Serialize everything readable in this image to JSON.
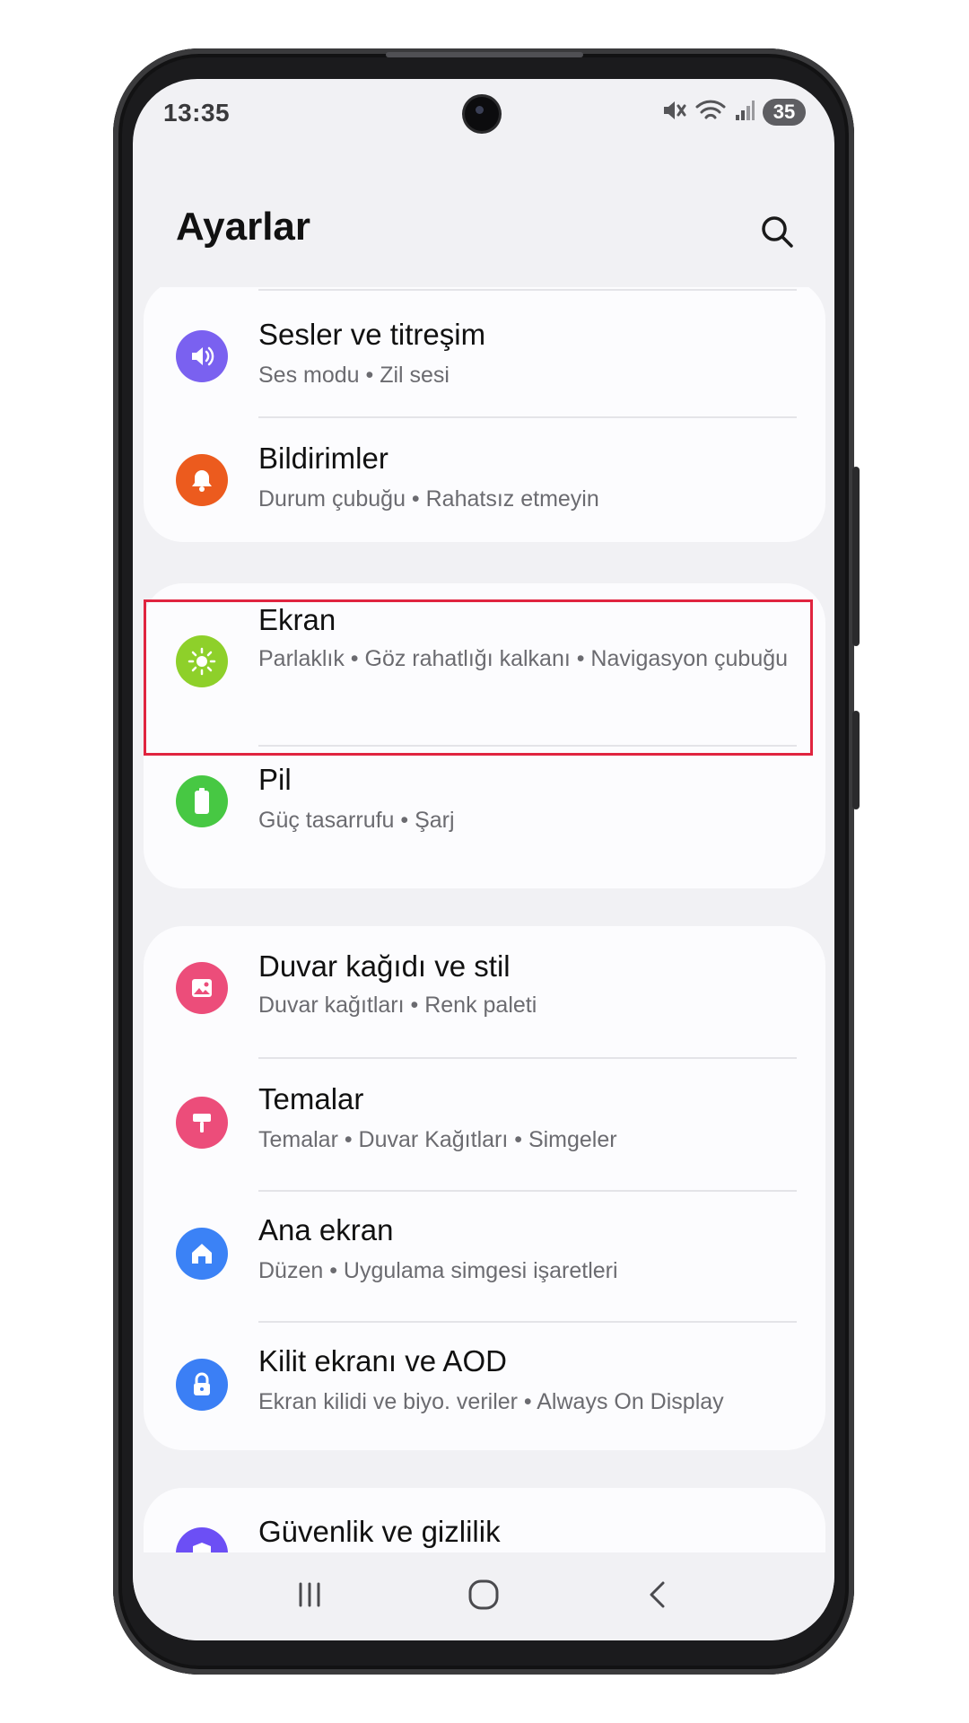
{
  "status_bar": {
    "time": "13:35",
    "battery_level": "35"
  },
  "header": {
    "title": "Ayarlar",
    "search_icon": "search-icon"
  },
  "groups": [
    {
      "items": [
        {
          "title": "Sesler ve titreşim",
          "subtitle": "Ses modu  •  Zil sesi",
          "icon": "speaker-icon",
          "color": "#7a61f0"
        },
        {
          "title": "Bildirimler",
          "subtitle": "Durum çubuğu  •  Rahatsız etmeyin",
          "icon": "bell-icon",
          "color": "#ec5b1e"
        }
      ]
    },
    {
      "items": [
        {
          "title": "Ekran",
          "subtitle": "Parlaklık  •  Göz rahatlığı kalkanı  •  Navigasyon çubuğu",
          "icon": "sun-icon",
          "color": "#8ed02a",
          "highlighted": true
        },
        {
          "title": "Pil",
          "subtitle": "Güç tasarrufu  •  Şarj",
          "icon": "battery-icon",
          "color": "#47c843"
        }
      ]
    },
    {
      "items": [
        {
          "title": "Duvar kağıdı ve stil",
          "subtitle": "Duvar kağıtları  •  Renk paleti",
          "icon": "image-icon",
          "color": "#ec4d7a"
        },
        {
          "title": "Temalar",
          "subtitle": "Temalar  •  Duvar Kağıtları  •  Simgeler",
          "icon": "brush-icon",
          "color": "#ec4d7a"
        },
        {
          "title": "Ana ekran",
          "subtitle": "Düzen  •  Uygulama simgesi işaretleri",
          "icon": "home-icon",
          "color": "#3b82f6"
        },
        {
          "title": "Kilit ekranı ve AOD",
          "subtitle": "Ekran kilidi ve biyo. veriler  •  Always On Display",
          "icon": "lock-icon",
          "color": "#3b7ff5"
        }
      ]
    },
    {
      "items": [
        {
          "title": "Güvenlik ve gizlilik",
          "subtitle": "",
          "icon": "shield-icon",
          "color": "#6c4ff5"
        }
      ]
    }
  ],
  "nav_bar": {
    "recents_icon": "recents-icon",
    "home_icon": "home-button-icon",
    "back_icon": "back-icon"
  },
  "colors": {
    "highlight_border": "#e0243f",
    "card_bg": "#fcfcfe",
    "screen_bg": "#f1f1f4"
  }
}
